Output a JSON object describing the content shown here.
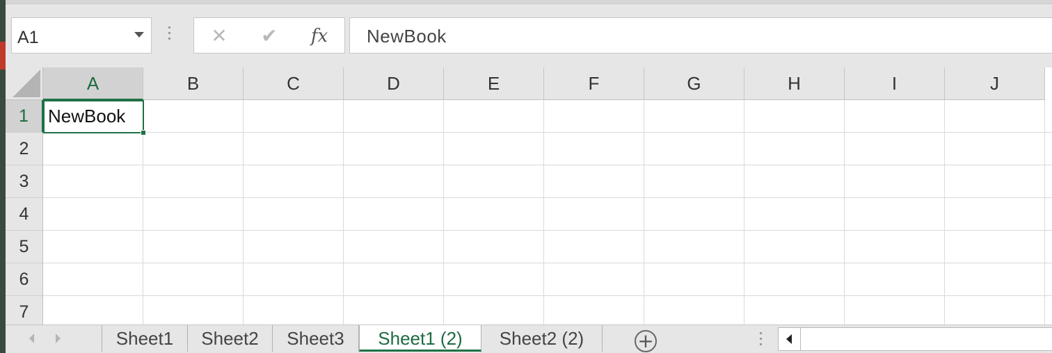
{
  "formula_bar": {
    "name_box_value": "A1",
    "formula_value": "NewBook",
    "cancel_icon": "✕",
    "enter_icon": "✔",
    "fx_label": "fx"
  },
  "grid": {
    "columns": [
      "A",
      "B",
      "C",
      "D",
      "E",
      "F",
      "G",
      "H",
      "I",
      "J"
    ],
    "rows": [
      "1",
      "2",
      "3",
      "4",
      "5",
      "6",
      "7"
    ],
    "selected_cell": "A1",
    "cells": {
      "A1": "NewBook"
    }
  },
  "sheet_tabs": {
    "tabs": [
      {
        "label": "Sheet1",
        "active": false
      },
      {
        "label": "Sheet2",
        "active": false
      },
      {
        "label": "Sheet3",
        "active": false
      },
      {
        "label": "Sheet1 (2)",
        "active": true
      },
      {
        "label": "Sheet2 (2)",
        "active": false
      }
    ],
    "add_sheet_icon": "+"
  },
  "colors": {
    "accent_green": "#1e7145",
    "header_bg": "#e6e6e6",
    "grid_line": "#d9d9d9"
  }
}
